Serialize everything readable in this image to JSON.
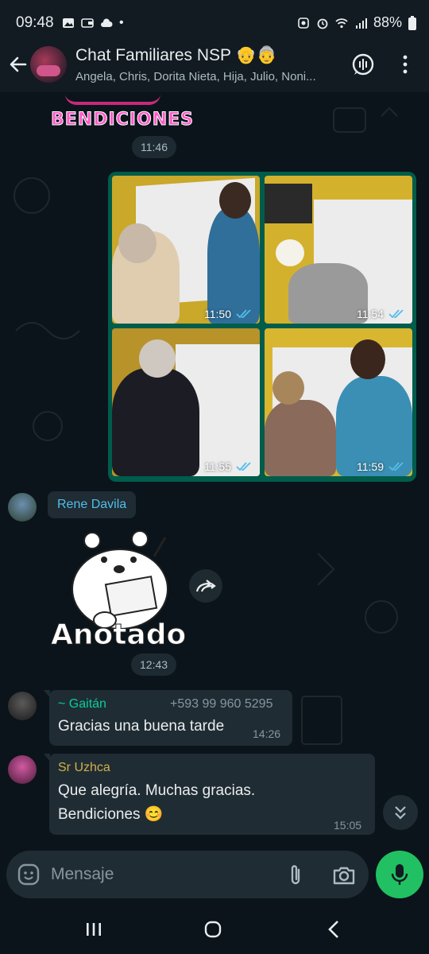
{
  "status_bar": {
    "time": "09:48",
    "dot": "•",
    "battery": "88%",
    "icons": [
      "image-icon",
      "wallet-icon",
      "cloud-icon",
      "recycle-icon",
      "alarm-icon",
      "wifi-icon",
      "signal-icon",
      "battery-icon"
    ]
  },
  "header": {
    "title": "Chat Familiares NSP",
    "title_emojis": "👴👵",
    "subtitle": "Angela, Chris, Dorita Nieta, Hija, Julio, Noni..."
  },
  "messages": {
    "sticker_top": {
      "text": "BENDICIONES",
      "time": "11:46"
    },
    "photos": [
      {
        "time": "11:50",
        "status": "read"
      },
      {
        "time": "11:54",
        "status": "read"
      },
      {
        "time": "11:55",
        "status": "read"
      },
      {
        "time": "11:59",
        "status": "read"
      }
    ],
    "rene": {
      "sender": "Rene Davila",
      "sticker_text": "Anotado",
      "time": "12:43"
    },
    "gaitan": {
      "sender": "~ Gaitán",
      "phone": "+593 99 960 5295",
      "text": "Gracias una buena tarde",
      "time": "14:26"
    },
    "uzhca": {
      "sender": "Sr Uzhca",
      "line1": "Que alegría. Muchas gracias.",
      "line2": "Bendiciones",
      "emoji": "😊",
      "time": "15:05"
    }
  },
  "input": {
    "placeholder": "Mensaje"
  },
  "colors": {
    "background": "#0b141a",
    "header": "#111b21",
    "bubble_in": "#202c33",
    "bubble_out": "#005c4b",
    "accent_green": "#21c063",
    "read_ticks": "#53bdeb",
    "gaitan_name": "#06cf9c",
    "uzhca_name": "#d1b04c"
  }
}
